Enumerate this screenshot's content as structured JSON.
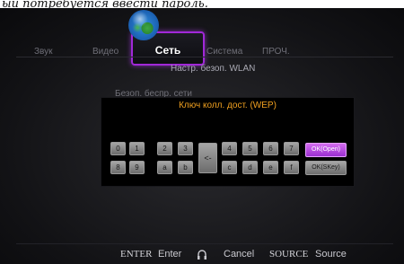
{
  "caption": "ый потребуется ввести пароль.",
  "menu": {
    "tabs": [
      {
        "label": "Звук"
      },
      {
        "label": "Видео"
      },
      {
        "label": "Сеть"
      },
      {
        "label": "Система"
      },
      {
        "label": "ПРОЧ."
      }
    ],
    "active_tab": "Сеть"
  },
  "subtitle": "Настр. безоп. WLAN",
  "ghost_label": "Безоп. беспр. сети",
  "dialog": {
    "title": "Ключ колл. дост. (WEP)",
    "row1": [
      "0",
      "1",
      "2",
      "3"
    ],
    "row1b": [
      "4",
      "5",
      "6",
      "7"
    ],
    "row2": [
      "8",
      "9",
      "a",
      "b"
    ],
    "row2b": [
      "c",
      "d",
      "e",
      "f"
    ],
    "backspace": "<-",
    "ok_open": "OK(Open)",
    "ok_skey": "OK(SKey)"
  },
  "footer": {
    "enter_key": "ENTER",
    "enter_label": "Enter",
    "cancel_label": "Cancel",
    "source_key": "SOURCE",
    "source_label": "Source"
  },
  "colors": {
    "accent": "#a128d8",
    "title_orange": "#f0a020"
  }
}
